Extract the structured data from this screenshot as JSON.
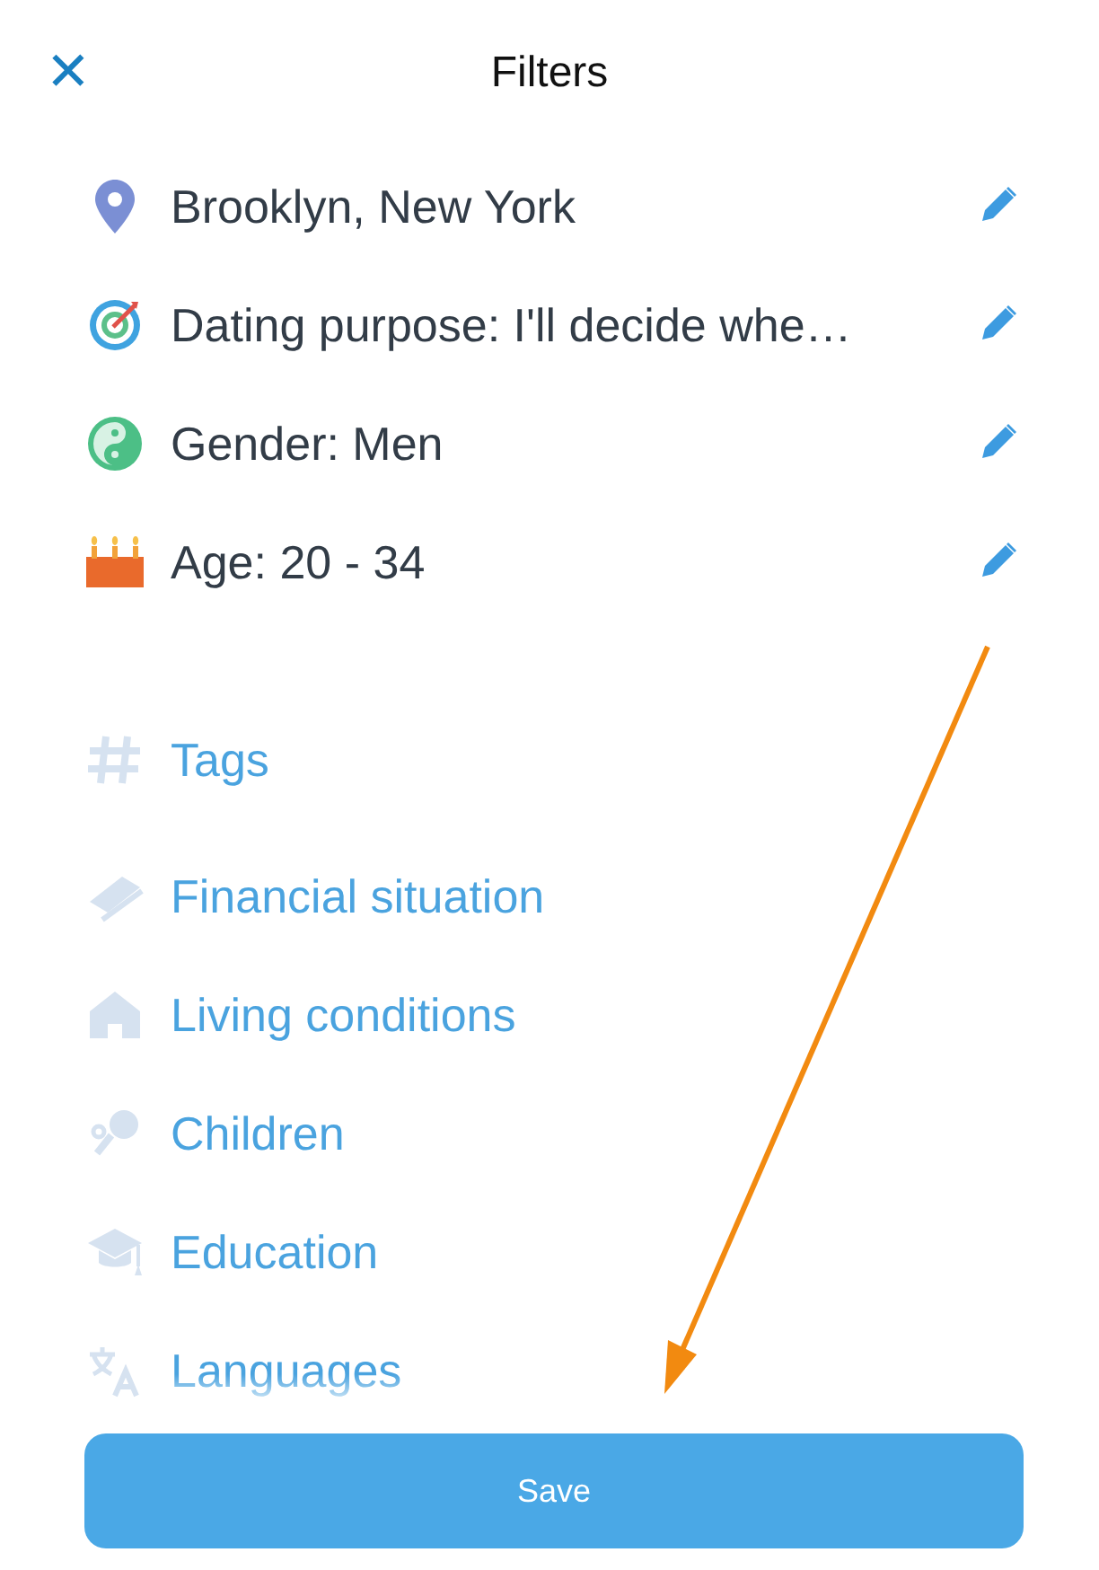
{
  "header": {
    "close": "✕",
    "title": "Filters"
  },
  "active_filters": [
    {
      "label": "Brooklyn, New York"
    },
    {
      "label": "Dating purpose: I'll decide whe…"
    },
    {
      "label": "Gender: Men"
    },
    {
      "label": "Age: 20 - 34"
    }
  ],
  "more_filters": [
    {
      "label": "Tags"
    },
    {
      "label": "Financial situation"
    },
    {
      "label": "Living conditions"
    },
    {
      "label": "Children"
    },
    {
      "label": "Education"
    },
    {
      "label": "Languages"
    }
  ],
  "save_button": "Save"
}
